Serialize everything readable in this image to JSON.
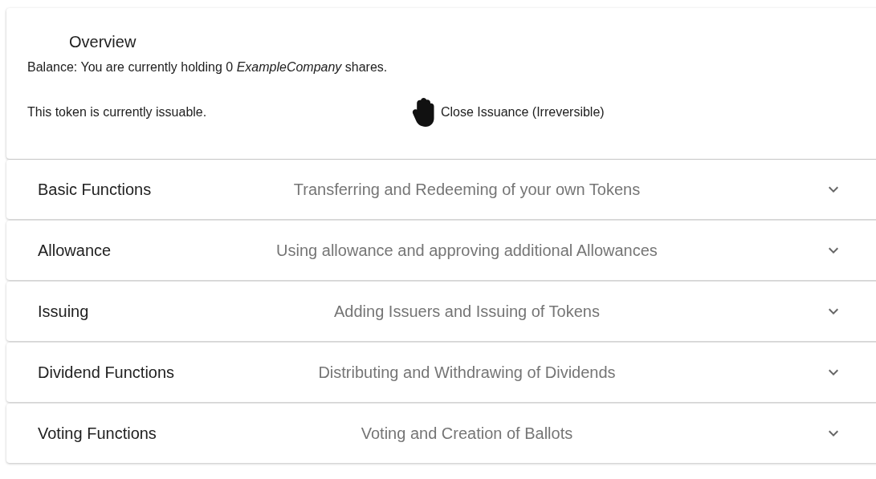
{
  "overview": {
    "title": "Overview",
    "balance": "Balance: You are currently holding 0 *ExampleCompany* shares.",
    "status": "This token is currently issuable.",
    "close_button": "Close Issuance (Irreversible)"
  },
  "sections": [
    {
      "title": "Basic Functions",
      "description": "Transferring and Redeeming of your own Tokens",
      "expanded": false
    },
    {
      "title": "Allowance",
      "description": "Using allowance and approving additional Allowances",
      "expanded": false
    },
    {
      "title": "Issuing",
      "description": "Adding Issuers and Issuing of Tokens",
      "expanded": false
    },
    {
      "title": "Dividend Functions",
      "description": "Distributing and Withdrawing of Dividends",
      "expanded": false
    },
    {
      "title": "Voting Functions",
      "description": "Voting and Creation of Ballots",
      "expanded": false
    }
  ]
}
